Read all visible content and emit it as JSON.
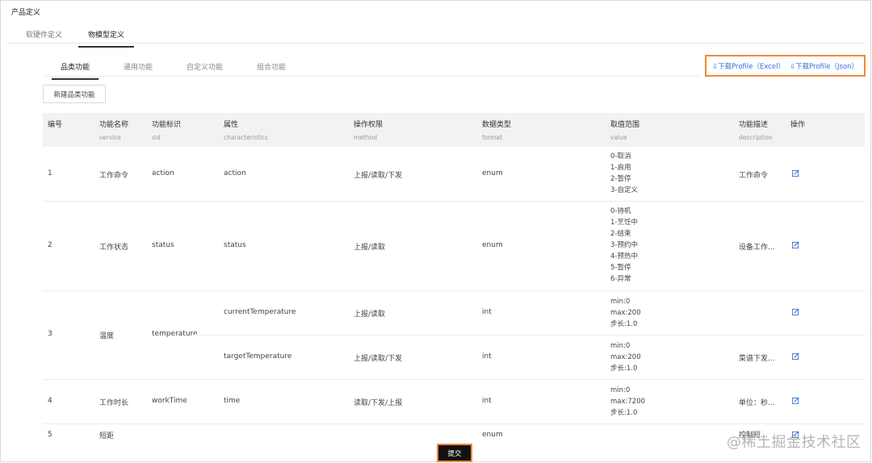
{
  "page_title": "产品定义",
  "top_tabs": [
    {
      "label": "软硬件定义"
    },
    {
      "label": "物模型定义"
    }
  ],
  "sub_tabs": [
    {
      "label": "品类功能"
    },
    {
      "label": "通用功能"
    },
    {
      "label": "自定义功能"
    },
    {
      "label": "组合功能"
    }
  ],
  "downloads": {
    "excel": "⇩下载Profile（Excel）",
    "json": "⇩下载Profile（Json）"
  },
  "new_button": "新建品类功能",
  "columns": [
    {
      "cn": "编号",
      "en": ""
    },
    {
      "cn": "功能名称",
      "en": "service"
    },
    {
      "cn": "功能标识",
      "en": "sid"
    },
    {
      "cn": "属性",
      "en": "characteristics"
    },
    {
      "cn": "操作权限",
      "en": "method"
    },
    {
      "cn": "数据类型",
      "en": "format"
    },
    {
      "cn": "取值范围",
      "en": "value"
    },
    {
      "cn": "功能描述",
      "en": "description"
    },
    {
      "cn": "操作",
      "en": ""
    }
  ],
  "rows": [
    {
      "id": "1",
      "service": "工作命令",
      "sid": "action",
      "characteristic": "action",
      "method": "上报/读取/下发",
      "format": "enum",
      "value": [
        "0-取消",
        "1-启用",
        "2-暂停",
        "3-自定义"
      ],
      "description": "工作命令"
    },
    {
      "id": "2",
      "service": "工作状态",
      "sid": "status",
      "characteristic": "status",
      "method": "上报/读取",
      "format": "enum",
      "value": [
        "0-待机",
        "1-烹饪中",
        "2-结束",
        "3-预约中",
        "4-预热中",
        "5-暂停",
        "6-异常"
      ],
      "description": "设备工作..."
    },
    {
      "id": "3",
      "service": "温度",
      "sid": "temperature",
      "sub": [
        {
          "characteristic": "currentTemperature",
          "method": "上报/读取",
          "format": "int",
          "value": [
            "min:0",
            "max:200",
            "步长:1.0"
          ],
          "description": ""
        },
        {
          "characteristic": "targetTemperature",
          "method": "上报/读取/下发",
          "format": "int",
          "value": [
            "min:0",
            "max:200",
            "步长:1.0"
          ],
          "description": "菜谱下发..."
        }
      ]
    },
    {
      "id": "4",
      "service": "工作时长",
      "sid": "workTime",
      "characteristic": "time",
      "method": "读取/下发/上报",
      "format": "int",
      "value": [
        "min:0",
        "max:7200",
        "步长:1.0"
      ],
      "description": "单位：秒..."
    },
    {
      "id": "5",
      "service": "短距",
      "sid": "",
      "characteristic": "",
      "method": "",
      "format": "enum",
      "value": [],
      "description": "控制短..."
    }
  ],
  "submit": "提交",
  "watermark": "@稀土掘金技术社区",
  "colors": {
    "accent_blue": "#3a6fd8",
    "highlight_orange": "#f08a3c"
  },
  "icons": {
    "edit": "edit-icon"
  }
}
